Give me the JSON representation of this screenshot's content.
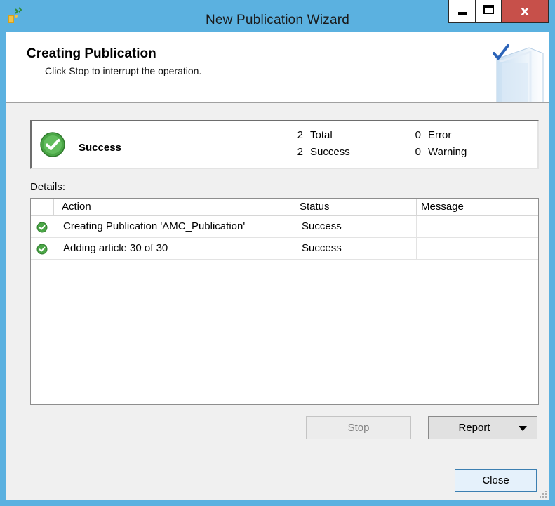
{
  "window": {
    "title": "New Publication Wizard",
    "controls": {
      "minimize": "minimize-icon",
      "maximize": "maximize-icon",
      "close_glyph": "x"
    }
  },
  "header": {
    "title": "Creating Publication",
    "subtitle": "Click Stop to interrupt the operation."
  },
  "summary": {
    "status": "Success",
    "total_count": "2",
    "total_label": "Total",
    "success_count": "2",
    "success_label": "Success",
    "error_count": "0",
    "error_label": "Error",
    "warning_count": "0",
    "warning_label": "Warning"
  },
  "details": {
    "label": "Details:",
    "columns": [
      "Action",
      "Status",
      "Message"
    ],
    "rows": [
      {
        "action": "Creating Publication 'AMC_Publication'",
        "status": "Success",
        "message": ""
      },
      {
        "action": "Adding article 30 of 30",
        "status": "Success",
        "message": ""
      }
    ]
  },
  "buttons": {
    "stop": "Stop",
    "report": "Report",
    "close": "Close"
  },
  "colors": {
    "titlebar": "#5bb1e0",
    "close_button": "#c7504a",
    "success_green": "#3f9a3a"
  }
}
